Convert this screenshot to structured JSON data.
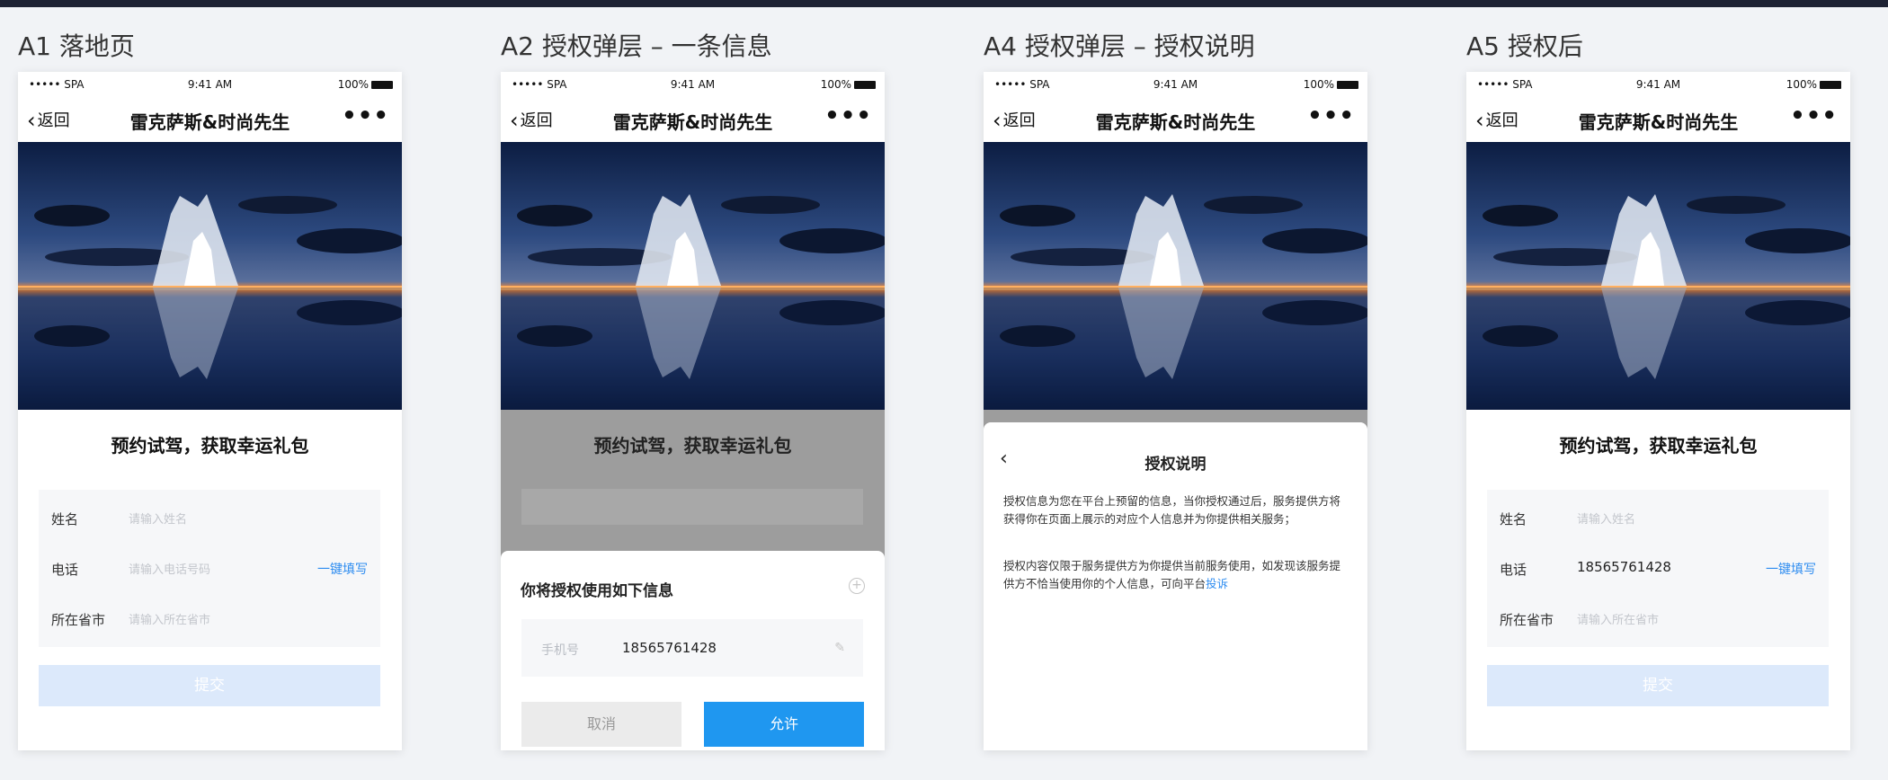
{
  "screens": [
    {
      "title": "A1 落地页",
      "status": {
        "signal": "••••• SPA",
        "time": "9:41 AM",
        "battery": "100%"
      },
      "nav": {
        "back": "返回",
        "title": "雷克萨斯&时尚先生",
        "more": "•••"
      },
      "form": {
        "heading": "预约试驾，获取幸运礼包",
        "fields": [
          {
            "label": "姓名",
            "placeholder": "请输入姓名"
          },
          {
            "label": "电话",
            "placeholder": "请输入电话号码",
            "action": "一键填写"
          },
          {
            "label": "所在省市",
            "placeholder": "请输入所在省市"
          }
        ],
        "submit": "提交"
      }
    },
    {
      "title": "A2 授权弹层 – 一条信息",
      "status": {
        "signal": "••••• SPA",
        "time": "9:41 AM",
        "battery": "100%"
      },
      "nav": {
        "back": "返回",
        "title": "雷克萨斯&时尚先生",
        "more": "•••"
      },
      "background_heading": "预约试驾，获取幸运礼包",
      "sheet": {
        "title": "你将授权使用如下信息",
        "plus": "+",
        "field_label": "手机号",
        "field_value": "18565761428",
        "edit": "✎",
        "cancel": "取消",
        "allow": "允许"
      }
    },
    {
      "title": "A4 授权弹层 – 授权说明",
      "status": {
        "signal": "••••• SPA",
        "time": "9:41 AM",
        "battery": "100%"
      },
      "nav": {
        "back": "返回",
        "title": "雷克萨斯&时尚先生",
        "more": "•••"
      },
      "sheet": {
        "back": "‹",
        "title": "授权说明",
        "paragraph1": "授权信息为您在平台上预留的信息，当你授权通过后，服务提供方将获得你在页面上展示的对应个人信息并为你提供相关服务；",
        "paragraph2": "授权内容仅限于服务提供方为你提供当前服务使用，如发现该服务提供方不恰当使用你的个人信息，可向平台",
        "link": "投诉"
      }
    },
    {
      "title": "A5 授权后",
      "status": {
        "signal": "••••• SPA",
        "time": "9:41 AM",
        "battery": "100%"
      },
      "nav": {
        "back": "返回",
        "title": "雷克萨斯&时尚先生",
        "more": "•••"
      },
      "form": {
        "heading": "预约试驾，获取幸运礼包",
        "fields": [
          {
            "label": "姓名",
            "placeholder": "请输入姓名"
          },
          {
            "label": "电话",
            "value": "18565761428",
            "action": "一键填写"
          },
          {
            "label": "所在省市",
            "placeholder": "请输入所在省市"
          }
        ],
        "submit": "提交"
      }
    }
  ]
}
